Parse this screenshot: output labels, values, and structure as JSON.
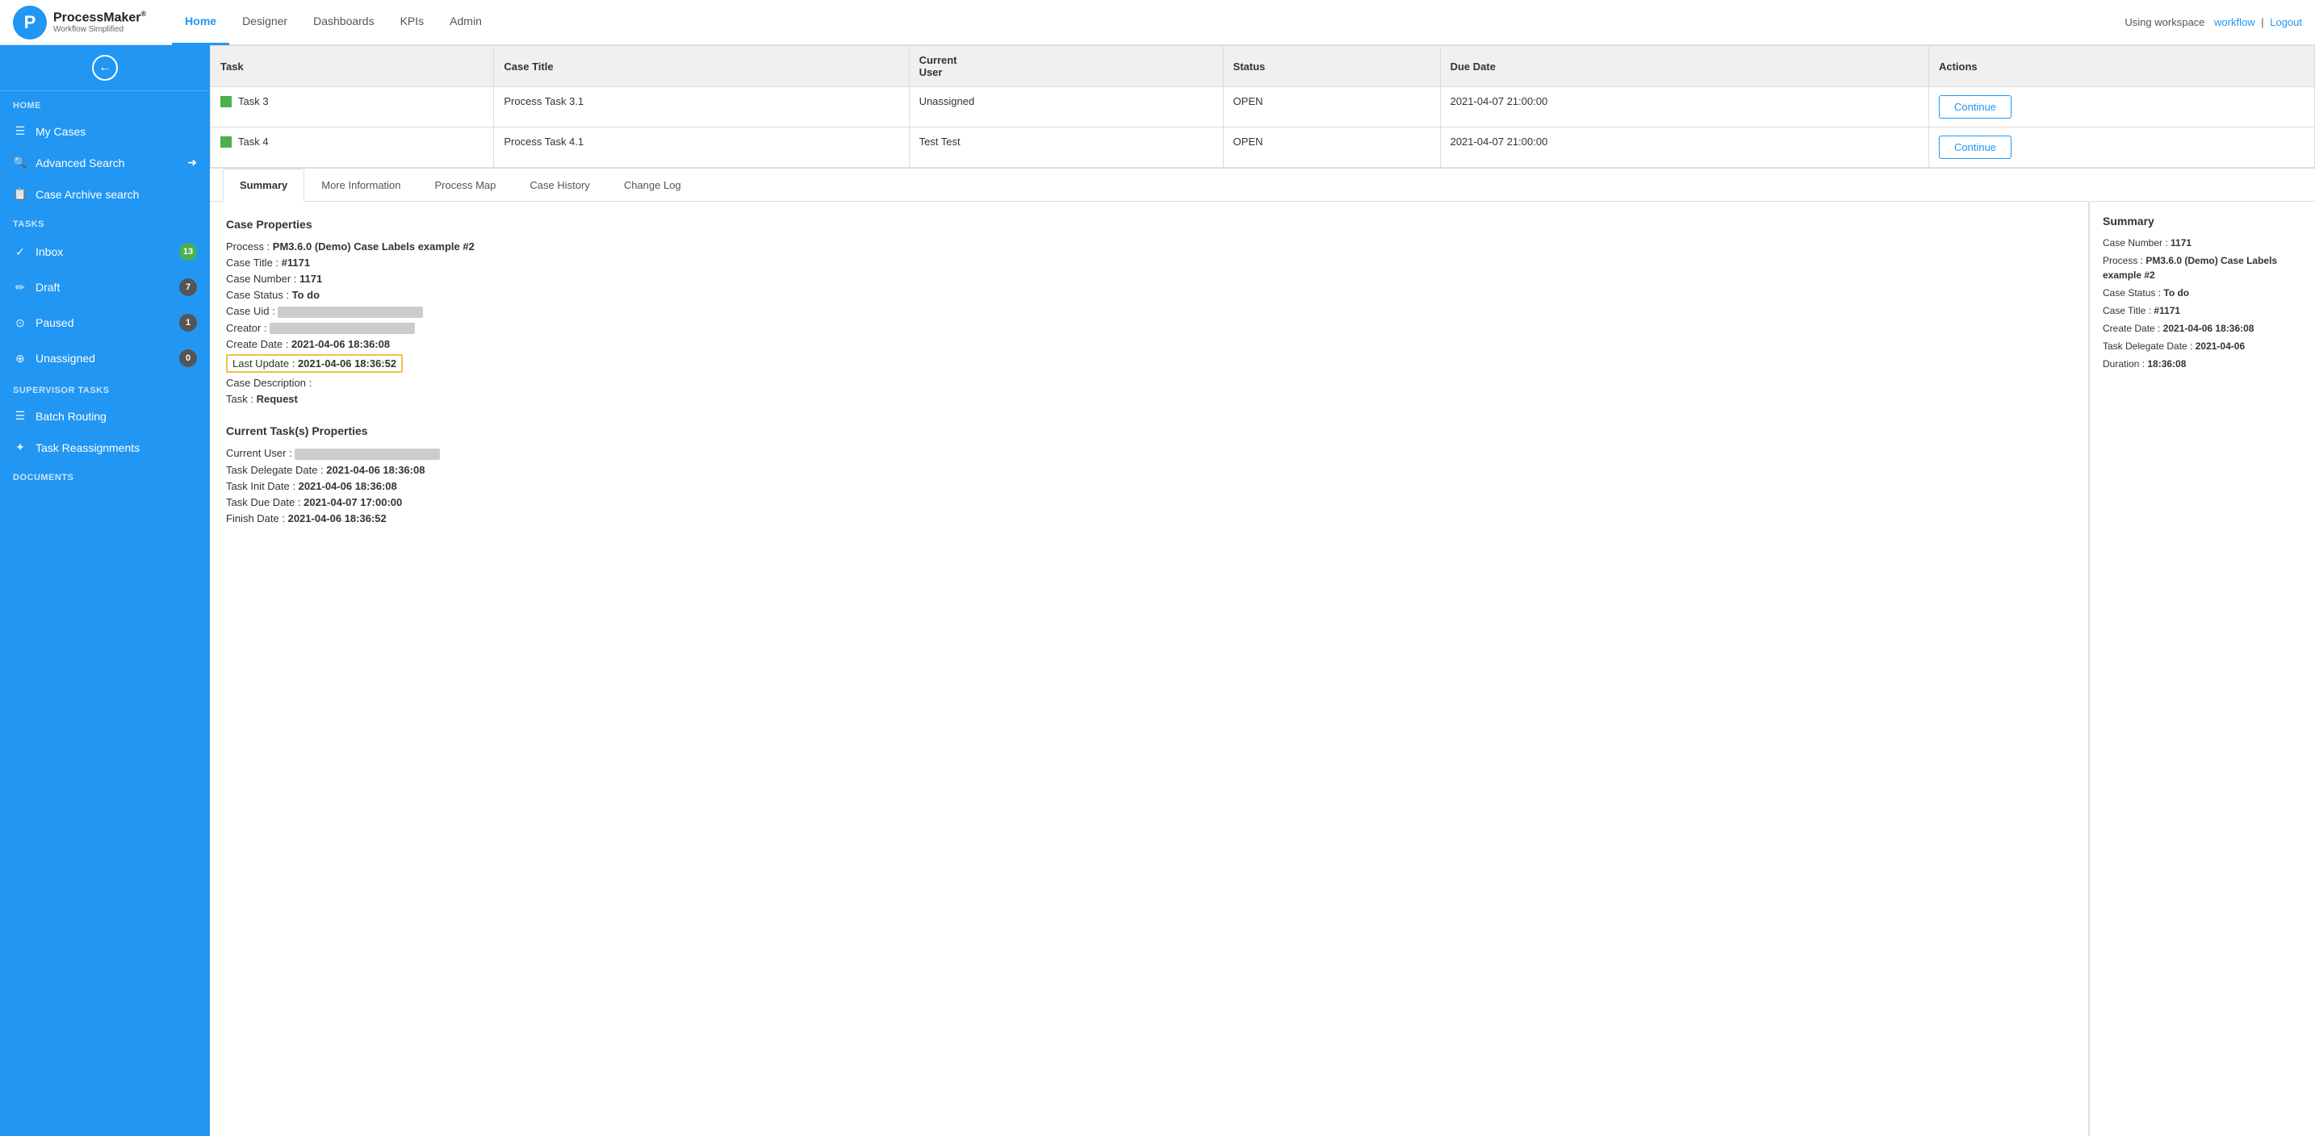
{
  "topNav": {
    "brand": "ProcessMaker",
    "trademark": "®",
    "tagline": "Workflow Simplified",
    "links": [
      "Home",
      "Designer",
      "Dashboards",
      "KPIs",
      "Admin"
    ],
    "activeLink": "Home",
    "workspaceLabel": "Using workspace",
    "workspaceName": "workflow",
    "logoutLabel": "Logout"
  },
  "sidebar": {
    "sections": [
      {
        "label": "HOME",
        "items": [
          {
            "icon": "☰",
            "label": "My Cases",
            "badge": null,
            "arrow": null
          },
          {
            "icon": "🔍",
            "label": "Advanced Search",
            "badge": null,
            "arrow": "→"
          },
          {
            "icon": "📋",
            "label": "Case Archive search",
            "badge": null,
            "arrow": null
          }
        ]
      },
      {
        "label": "TASKS",
        "items": [
          {
            "icon": "✓",
            "label": "Inbox",
            "badge": "13",
            "badgeColor": "green",
            "arrow": null
          },
          {
            "icon": "✎",
            "label": "Draft",
            "badge": "7",
            "badgeColor": "dark",
            "arrow": null
          },
          {
            "icon": "⊙",
            "label": "Paused",
            "badge": "1",
            "badgeColor": "dark",
            "arrow": null
          },
          {
            "icon": "⊕",
            "label": "Unassigned",
            "badge": "0",
            "badgeColor": "dark",
            "arrow": null
          }
        ]
      },
      {
        "label": "SUPERVISOR TASKS",
        "items": [
          {
            "icon": "☰",
            "label": "Batch Routing",
            "badge": null,
            "arrow": null
          },
          {
            "icon": "✦",
            "label": "Task Reassignments",
            "badge": null,
            "arrow": null
          }
        ]
      },
      {
        "label": "DOCUMENTS",
        "items": []
      }
    ]
  },
  "table": {
    "columns": [
      "Task",
      "Case Title",
      "Current User",
      "Status",
      "Due Date",
      "Actions"
    ],
    "rows": [
      {
        "task": "Task 3",
        "caseTitle": "Process Task 3.1",
        "currentUser": "Unassigned",
        "status": "OPEN",
        "dueDate": "2021-04-07 21:00:00",
        "action": "Continue"
      },
      {
        "task": "Task 4",
        "caseTitle": "Process Task 4.1",
        "currentUser": "Test Test",
        "status": "OPEN",
        "dueDate": "2021-04-07 21:00:00",
        "action": "Continue"
      }
    ]
  },
  "tabs": [
    "Summary",
    "More Information",
    "Process Map",
    "Case History",
    "Change Log"
  ],
  "activeTab": "Summary",
  "caseProperties": {
    "title": "Case Properties",
    "process": "PM3.6.0 (Demo) Case Labels example #2",
    "caseTitle": "#1171",
    "caseNumber": "1171",
    "caseStatus": "To do",
    "caseUid": "",
    "creator": "",
    "createDate": "2021-04-06 18:36:08",
    "lastUpdate": "2021-04-06 18:36:52",
    "caseDescription": "",
    "task": "Request"
  },
  "currentTaskProperties": {
    "title": "Current Task(s) Properties",
    "currentUser": "",
    "taskDelegateDate": "2021-04-06 18:36:08",
    "taskInitDate": "2021-04-06 18:36:08",
    "taskDueDate": "2021-04-07 17:00:00",
    "finishDate": "2021-04-06 18:36:52"
  },
  "rightSummary": {
    "title": "Summary",
    "caseNumber": "1171",
    "process": "PM3.6.0 (Demo) Case Labels example #2",
    "caseStatus": "To do",
    "caseTitle": "#1171",
    "createDate": "2021-04-06 18:36:08",
    "taskDelegateDate": "2021-04-06",
    "duration": "18:36:08"
  }
}
